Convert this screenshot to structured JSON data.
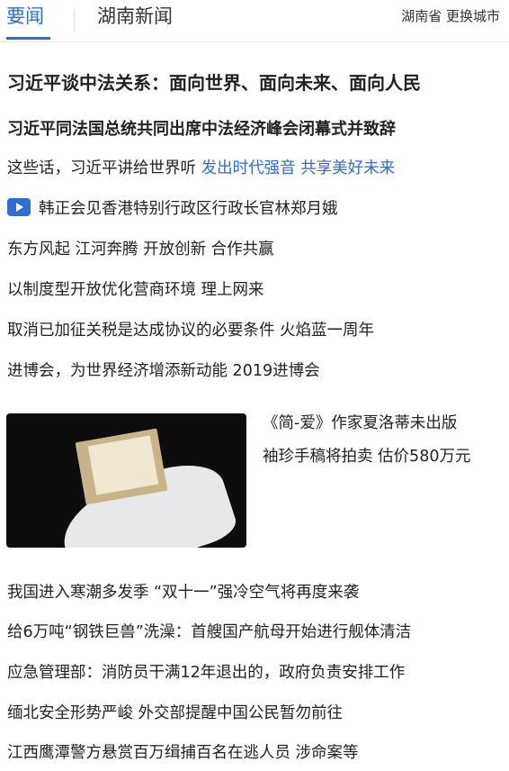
{
  "tabs": {
    "active": "要闻",
    "other": "湖南新闻"
  },
  "location": {
    "province": "湖南省",
    "change_city": "更换城市"
  },
  "headline_main": "习近平谈中法关系：面向世界、面向未来、面向人民",
  "headline_sub": "习近平同法国总统共同出席中法经济峰会闭幕式并致辞",
  "line1": {
    "text": "这些话，习近平讲给世界听",
    "link1": "发出时代强音",
    "link2": "共享美好未来"
  },
  "line2": {
    "icon": "video-play-icon",
    "text": "韩正会见香港特别行政区行政长官林郑月娥"
  },
  "line3": "东方风起 江河奔腾 开放创新 合作共赢",
  "line4": "以制度型开放优化营商环境 理上网来",
  "line5": "取消已加征关税是达成协议的必要条件 火焰蓝一周年",
  "line6": "进博会，为世界经济增添新动能 2019进博会",
  "photo_story": {
    "caption_line1": "《简-爱》作家夏洛蒂未出版",
    "caption_line2": "袖珍手稿将拍卖 估价580万元"
  },
  "news": [
    "我国进入寒潮多发季 “双十一”强冷空气将再度来袭",
    "给6万吨“钢铁巨兽”洗澡：首艘国产航母开始进行舰体清洁",
    "应急管理部：消防员干满12年退出的，政府负责安排工作",
    "缅北安全形势严峻 外交部提醒中国公民暂勿前往",
    "江西鹰潭警方悬赏百万缉捕百名在逃人员 涉命案等"
  ],
  "colors": {
    "accent": "#2f6dd2",
    "text": "#222222"
  }
}
